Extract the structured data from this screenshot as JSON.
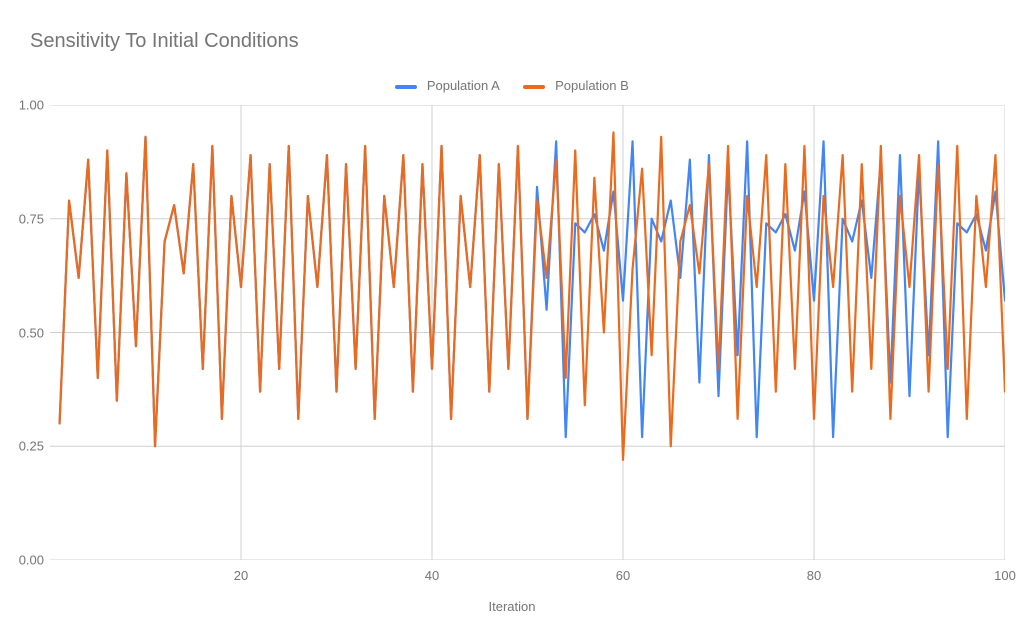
{
  "chart_data": {
    "type": "line",
    "title": "Sensitivity To Initial Conditions",
    "xlabel": "Iteration",
    "ylabel": "",
    "xlim": [
      0,
      100
    ],
    "ylim": [
      0.0,
      1.0
    ],
    "xticks": [
      20,
      40,
      60,
      80,
      100
    ],
    "yticks": [
      0.0,
      0.25,
      0.5,
      0.75,
      1.0
    ],
    "x": [
      1,
      2,
      3,
      4,
      5,
      6,
      7,
      8,
      9,
      10,
      11,
      12,
      13,
      14,
      15,
      16,
      17,
      18,
      19,
      20,
      21,
      22,
      23,
      24,
      25,
      26,
      27,
      28,
      29,
      30,
      31,
      32,
      33,
      34,
      35,
      36,
      37,
      38,
      39,
      40,
      41,
      42,
      43,
      44,
      45,
      46,
      47,
      48,
      49,
      50,
      51,
      52,
      53,
      54,
      55,
      56,
      57,
      58,
      59,
      60,
      61,
      62,
      63,
      64,
      65,
      66,
      67,
      68,
      69,
      70,
      71,
      72,
      73,
      74,
      75,
      76,
      77,
      78,
      79,
      80,
      81,
      82,
      83,
      84,
      85,
      86,
      87,
      88,
      89,
      90,
      91,
      92,
      93,
      94,
      95,
      96,
      97,
      98,
      99,
      100
    ],
    "series": [
      {
        "name": "Population A",
        "color": "#4285F4",
        "values": [
          0.3,
          0.79,
          0.62,
          0.88,
          0.4,
          0.9,
          0.35,
          0.85,
          0.47,
          0.93,
          0.25,
          0.7,
          0.78,
          0.63,
          0.87,
          0.42,
          0.91,
          0.31,
          0.8,
          0.6,
          0.89,
          0.37,
          0.87,
          0.42,
          0.91,
          0.31,
          0.8,
          0.6,
          0.89,
          0.37,
          0.87,
          0.42,
          0.91,
          0.31,
          0.8,
          0.6,
          0.89,
          0.37,
          0.87,
          0.42,
          0.91,
          0.31,
          0.8,
          0.6,
          0.89,
          0.37,
          0.87,
          0.42,
          0.91,
          0.31,
          0.82,
          0.55,
          0.92,
          0.27,
          0.74,
          0.72,
          0.76,
          0.68,
          0.81,
          0.57,
          0.92,
          0.27,
          0.75,
          0.7,
          0.79,
          0.62,
          0.88,
          0.39,
          0.89,
          0.36,
          0.86,
          0.45,
          0.92,
          0.27,
          0.74,
          0.72,
          0.76,
          0.68,
          0.81,
          0.57,
          0.92,
          0.27,
          0.75,
          0.7,
          0.79,
          0.62,
          0.88,
          0.39,
          0.89,
          0.36,
          0.86,
          0.45,
          0.92,
          0.27,
          0.74,
          0.72,
          0.76,
          0.68,
          0.81,
          0.57
        ]
      },
      {
        "name": "Population B",
        "color": "#EA6A1F",
        "values": [
          0.3,
          0.79,
          0.62,
          0.88,
          0.4,
          0.9,
          0.35,
          0.85,
          0.47,
          0.93,
          0.25,
          0.7,
          0.78,
          0.63,
          0.87,
          0.42,
          0.91,
          0.31,
          0.8,
          0.6,
          0.89,
          0.37,
          0.87,
          0.42,
          0.91,
          0.31,
          0.8,
          0.6,
          0.89,
          0.37,
          0.87,
          0.42,
          0.91,
          0.31,
          0.8,
          0.6,
          0.89,
          0.37,
          0.87,
          0.42,
          0.91,
          0.31,
          0.8,
          0.6,
          0.89,
          0.37,
          0.87,
          0.42,
          0.91,
          0.31,
          0.79,
          0.62,
          0.88,
          0.4,
          0.9,
          0.34,
          0.84,
          0.5,
          0.94,
          0.22,
          0.64,
          0.86,
          0.45,
          0.93,
          0.25,
          0.7,
          0.78,
          0.63,
          0.87,
          0.42,
          0.91,
          0.31,
          0.8,
          0.6,
          0.89,
          0.37,
          0.87,
          0.42,
          0.91,
          0.31,
          0.8,
          0.6,
          0.89,
          0.37,
          0.87,
          0.42,
          0.91,
          0.31,
          0.8,
          0.6,
          0.89,
          0.37,
          0.87,
          0.42,
          0.91,
          0.31,
          0.8,
          0.6,
          0.89,
          0.37
        ]
      }
    ]
  },
  "legend": {
    "a": "Population A",
    "b": "Population B"
  }
}
